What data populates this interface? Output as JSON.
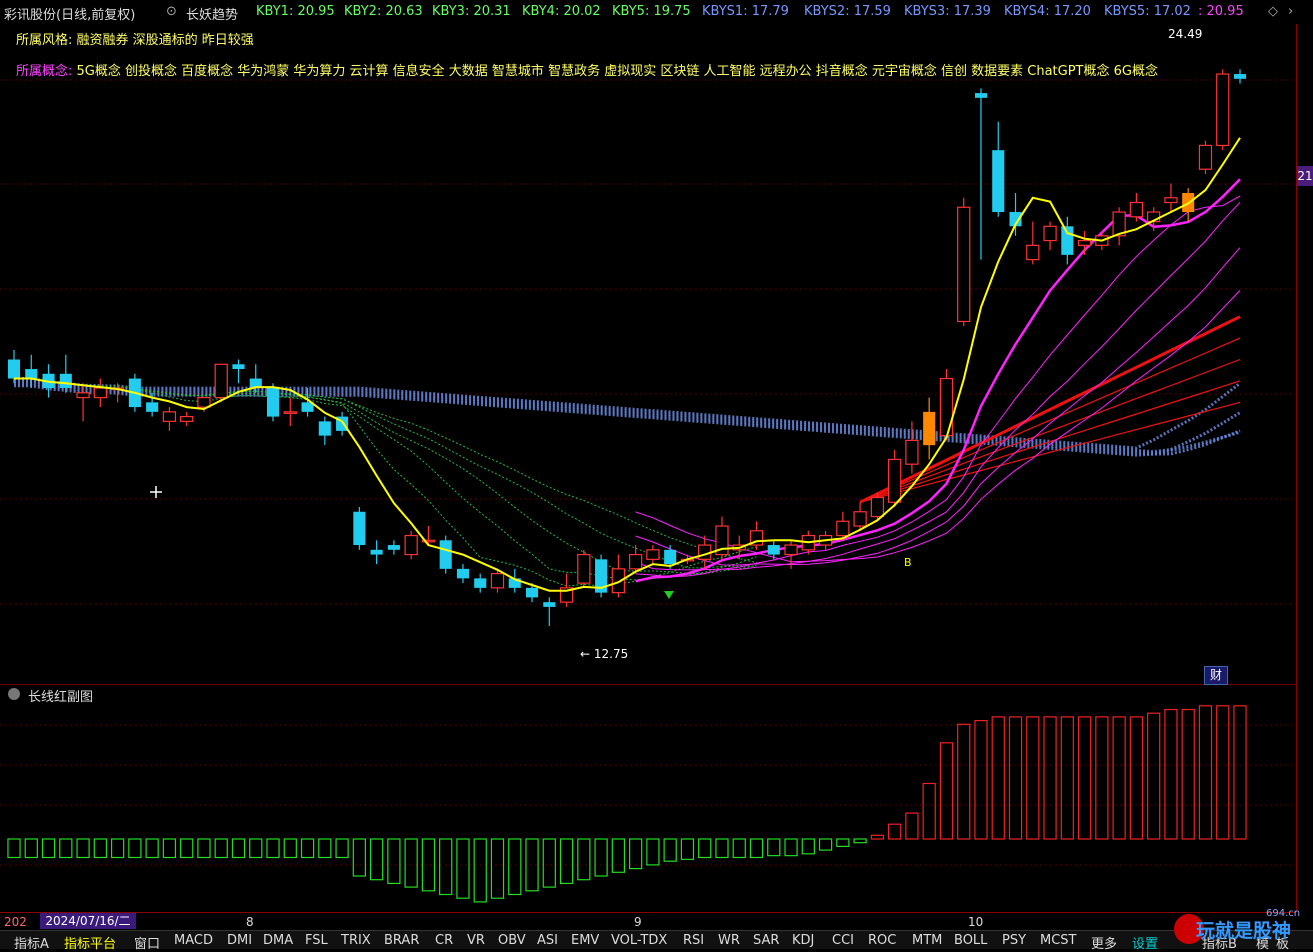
{
  "header": {
    "stock_name": "彩讯股份(日线,前复权)",
    "indicator_name": "长妖趋势",
    "kby": [
      {
        "label": "KBY1: 20.95"
      },
      {
        "label": "KBY2: 20.63"
      },
      {
        "label": "KBY3: 20.31"
      },
      {
        "label": "KBY4: 20.02"
      },
      {
        "label": "KBY5: 19.75"
      }
    ],
    "kbys": [
      {
        "label": "KBYS1: 17.79"
      },
      {
        "label": "KBYS2: 17.59"
      },
      {
        "label": "KBYS3: 17.39"
      },
      {
        "label": "KBYS4: 17.20"
      },
      {
        "label": "KBYS5: 17.02"
      }
    ],
    "last_value": ": 20.95",
    "style_label": "所属风格:",
    "style_text": "融资融券 深股通标的 昨日较强",
    "concept_label": "所属概念:",
    "concept_text": "5G概念 创投概念 百度概念 华为鸿蒙 华为算力 云计算 信息安全 大数据 智慧城市 智慧政务 虚拟现实 区块链 人工智能 远程办公 抖音概念 元宇宙概念 信创 数据要素 ChatGPT概念 6G概念"
  },
  "main_chart": {
    "high_label": "24.49",
    "low_label": "12.75",
    "price_tag": "21",
    "cai_badge": "财",
    "signal_label": "B"
  },
  "sub_chart": {
    "title": "长线红副图"
  },
  "date_axis": {
    "selected_date": "2024/07/16/二",
    "year_prefix": "202",
    "months": [
      "8",
      "9",
      "10"
    ]
  },
  "tabs": [
    "指标A",
    "指标平台",
    "窗口",
    "MACD",
    "DMI",
    "DMA",
    "FSL",
    "TRIX",
    "BRAR",
    "CR",
    "VR",
    "OBV",
    "ASI",
    "EMV",
    "VOL-TDX",
    "RSI",
    "WR",
    "SAR",
    "KDJ",
    "CCI",
    "ROC",
    "MTM",
    "BOLL",
    "PSY",
    "MCST",
    "更多",
    "设置",
    "指标B",
    "模",
    "板"
  ],
  "watermark": "玩就是股神",
  "watermark_site": "694.cn",
  "colors": {
    "up": "#ff3333",
    "down": "#22ccee",
    "ma_yellow": "#ffff00",
    "ma_magenta": "#ff22ff",
    "long_red": "#ee1111",
    "dotted_blue": "#6688dd",
    "dotted_green": "#22bb44"
  },
  "chart_data": {
    "type": "candlestick",
    "candles": [
      {
        "o": 18.4,
        "h": 18.6,
        "c": 18.0,
        "l": 17.9
      },
      {
        "o": 18.2,
        "h": 18.5,
        "c": 18.0,
        "l": 17.8
      },
      {
        "o": 18.1,
        "h": 18.3,
        "c": 17.8,
        "l": 17.6
      },
      {
        "o": 18.1,
        "h": 18.5,
        "c": 17.8,
        "l": 17.7
      },
      {
        "o": 17.6,
        "h": 17.9,
        "c": 17.7,
        "l": 17.1
      },
      {
        "o": 17.6,
        "h": 18.0,
        "c": 17.8,
        "l": 17.4
      },
      {
        "o": 17.8,
        "h": 17.9,
        "c": 17.8,
        "l": 17.5
      },
      {
        "o": 18.0,
        "h": 18.1,
        "c": 17.4,
        "l": 17.3
      },
      {
        "o": 17.5,
        "h": 17.7,
        "c": 17.3,
        "l": 17.2
      },
      {
        "o": 17.1,
        "h": 17.4,
        "c": 17.3,
        "l": 16.9
      },
      {
        "o": 17.1,
        "h": 17.3,
        "c": 17.2,
        "l": 17.0
      },
      {
        "o": 17.4,
        "h": 17.6,
        "c": 17.6,
        "l": 17.3
      },
      {
        "o": 17.6,
        "h": 18.3,
        "c": 18.3,
        "l": 17.5
      },
      {
        "o": 18.3,
        "h": 18.4,
        "c": 18.2,
        "l": 17.9
      },
      {
        "o": 18.0,
        "h": 18.3,
        "c": 17.8,
        "l": 17.7
      },
      {
        "o": 17.8,
        "h": 17.9,
        "c": 17.2,
        "l": 17.1
      },
      {
        "o": 17.3,
        "h": 17.6,
        "c": 17.3,
        "l": 17.0
      },
      {
        "o": 17.5,
        "h": 17.8,
        "c": 17.3,
        "l": 17.2
      },
      {
        "o": 17.1,
        "h": 17.2,
        "c": 16.8,
        "l": 16.6
      },
      {
        "o": 17.2,
        "h": 17.3,
        "c": 16.9,
        "l": 16.8
      },
      {
        "o": 15.2,
        "h": 15.3,
        "c": 14.5,
        "l": 14.4
      },
      {
        "o": 14.4,
        "h": 14.6,
        "c": 14.3,
        "l": 14.1
      },
      {
        "o": 14.5,
        "h": 14.6,
        "c": 14.4,
        "l": 14.3
      },
      {
        "o": 14.3,
        "h": 14.8,
        "c": 14.7,
        "l": 14.2
      },
      {
        "o": 14.6,
        "h": 14.9,
        "c": 14.6,
        "l": 14.5
      },
      {
        "o": 14.6,
        "h": 14.7,
        "c": 14.0,
        "l": 13.9
      },
      {
        "o": 14.0,
        "h": 14.1,
        "c": 13.8,
        "l": 13.7
      },
      {
        "o": 13.8,
        "h": 13.9,
        "c": 13.6,
        "l": 13.5
      },
      {
        "o": 13.6,
        "h": 14.0,
        "c": 13.9,
        "l": 13.5
      },
      {
        "o": 13.8,
        "h": 14.0,
        "c": 13.6,
        "l": 13.5
      },
      {
        "o": 13.6,
        "h": 13.7,
        "c": 13.4,
        "l": 13.3
      },
      {
        "o": 13.3,
        "h": 13.4,
        "c": 13.2,
        "l": 12.8
      },
      {
        "o": 13.3,
        "h": 13.9,
        "c": 13.6,
        "l": 13.2
      },
      {
        "o": 13.7,
        "h": 14.4,
        "c": 14.3,
        "l": 13.6
      },
      {
        "o": 14.2,
        "h": 14.3,
        "c": 13.5,
        "l": 13.4
      },
      {
        "o": 13.5,
        "h": 14.3,
        "c": 14.0,
        "l": 13.4
      },
      {
        "o": 14.0,
        "h": 14.5,
        "c": 14.3,
        "l": 13.9
      },
      {
        "o": 14.2,
        "h": 14.5,
        "c": 14.4,
        "l": 14.1
      },
      {
        "o": 14.4,
        "h": 14.5,
        "c": 14.1,
        "l": 14.0
      },
      {
        "o": 14.2,
        "h": 14.3,
        "c": 14.2,
        "l": 14.1
      },
      {
        "o": 14.2,
        "h": 14.7,
        "c": 14.5,
        "l": 14.0
      },
      {
        "o": 14.3,
        "h": 15.1,
        "c": 14.9,
        "l": 14.2
      },
      {
        "o": 14.4,
        "h": 14.7,
        "c": 14.5,
        "l": 14.2
      },
      {
        "o": 14.5,
        "h": 15.0,
        "c": 14.8,
        "l": 14.4
      },
      {
        "o": 14.5,
        "h": 14.6,
        "c": 14.3,
        "l": 14.2
      },
      {
        "o": 14.3,
        "h": 14.6,
        "c": 14.5,
        "l": 14.0
      },
      {
        "o": 14.4,
        "h": 14.8,
        "c": 14.7,
        "l": 14.3
      },
      {
        "o": 14.5,
        "h": 14.8,
        "c": 14.7,
        "l": 14.4
      },
      {
        "o": 14.7,
        "h": 15.2,
        "c": 15.0,
        "l": 14.6
      },
      {
        "o": 14.9,
        "h": 15.4,
        "c": 15.2,
        "l": 14.8
      },
      {
        "o": 15.1,
        "h": 15.6,
        "c": 15.5,
        "l": 15.0
      },
      {
        "o": 15.4,
        "h": 16.5,
        "c": 16.3,
        "l": 15.3
      },
      {
        "o": 16.2,
        "h": 17.1,
        "c": 16.7,
        "l": 16.0
      },
      {
        "o": 16.6,
        "h": 17.6,
        "c": 17.3,
        "l": 16.3
      },
      {
        "o": 16.8,
        "h": 18.2,
        "c": 18.0,
        "l": 16.7
      },
      {
        "o": 19.2,
        "h": 21.8,
        "c": 21.6,
        "l": 19.1
      },
      {
        "o": 24.0,
        "h": 24.1,
        "c": 23.9,
        "l": 20.5
      },
      {
        "o": 22.8,
        "h": 23.4,
        "c": 21.5,
        "l": 21.4
      },
      {
        "o": 21.5,
        "h": 21.9,
        "c": 21.2,
        "l": 21.0
      },
      {
        "o": 20.5,
        "h": 21.3,
        "c": 20.8,
        "l": 20.4
      },
      {
        "o": 20.9,
        "h": 21.3,
        "c": 21.2,
        "l": 20.7
      },
      {
        "o": 21.2,
        "h": 21.4,
        "c": 20.6,
        "l": 20.4
      },
      {
        "o": 20.8,
        "h": 21.1,
        "c": 20.9,
        "l": 20.6
      },
      {
        "o": 20.8,
        "h": 21.1,
        "c": 21.0,
        "l": 20.7
      },
      {
        "o": 21.0,
        "h": 21.6,
        "c": 21.5,
        "l": 20.8
      },
      {
        "o": 21.4,
        "h": 21.9,
        "c": 21.7,
        "l": 21.3
      },
      {
        "o": 21.3,
        "h": 21.6,
        "c": 21.5,
        "l": 21.1
      },
      {
        "o": 21.7,
        "h": 22.1,
        "c": 21.8,
        "l": 21.5
      },
      {
        "o": 21.5,
        "h": 22.0,
        "c": 21.9,
        "l": 21.3
      },
      {
        "o": 22.4,
        "h": 23.0,
        "c": 22.9,
        "l": 22.3
      },
      {
        "o": 22.9,
        "h": 24.5,
        "c": 24.4,
        "l": 22.8
      },
      {
        "o": 24.4,
        "h": 24.5,
        "c": 24.3,
        "l": 24.2
      }
    ],
    "sub_values": [
      -10,
      -10,
      -10,
      -10,
      -10,
      -10,
      -10,
      -10,
      -10,
      -10,
      -10,
      -10,
      -10,
      -10,
      -10,
      -10,
      -10,
      -10,
      -10,
      -10,
      -20,
      -22,
      -24,
      -26,
      -28,
      -30,
      -32,
      -34,
      -32,
      -30,
      -28,
      -26,
      -24,
      -22,
      -20,
      -18,
      -16,
      -14,
      -12,
      -11,
      -10,
      -10,
      -10,
      -10,
      -9,
      -9,
      -8,
      -6,
      -4,
      -2,
      2,
      8,
      14,
      30,
      52,
      62,
      64,
      66,
      66,
      66,
      66,
      66,
      66,
      66,
      66,
      66,
      68,
      70,
      70,
      72,
      72,
      72
    ],
    "ylim": [
      12.0,
      25.2
    ]
  }
}
